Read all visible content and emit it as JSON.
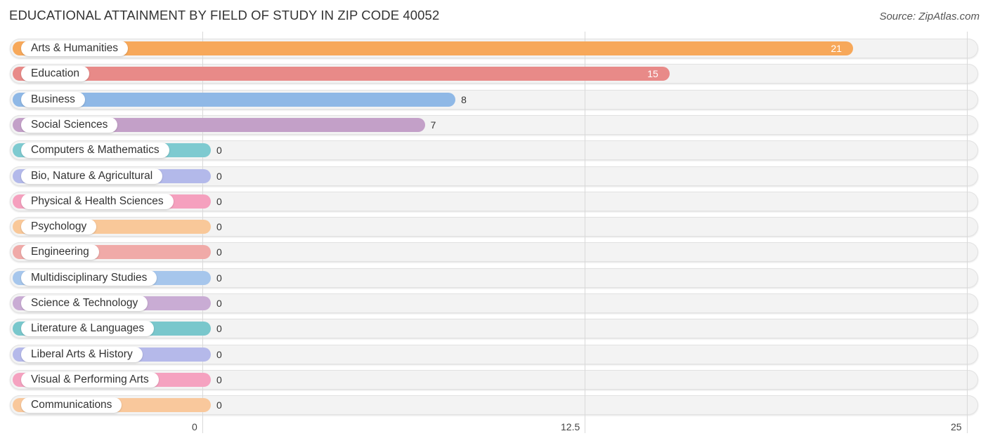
{
  "title": "EDUCATIONAL ATTAINMENT BY FIELD OF STUDY IN ZIP CODE 40052",
  "source": "Source: ZipAtlas.com",
  "chart_data": {
    "type": "bar",
    "orientation": "horizontal",
    "title": "EDUCATIONAL ATTAINMENT BY FIELD OF STUDY IN ZIP CODE 40052",
    "xlabel": "",
    "ylabel": "",
    "xlim": [
      0,
      25
    ],
    "xticks": [
      "0",
      "12.5",
      "25"
    ],
    "grid": true,
    "categories": [
      "Arts & Humanities",
      "Education",
      "Business",
      "Social Sciences",
      "Computers & Mathematics",
      "Bio, Nature & Agricultural",
      "Physical & Health Sciences",
      "Psychology",
      "Engineering",
      "Multidisciplinary Studies",
      "Science & Technology",
      "Literature & Languages",
      "Liberal Arts & History",
      "Visual & Performing Arts",
      "Communications"
    ],
    "values": [
      21,
      15,
      8,
      7,
      0,
      0,
      0,
      0,
      0,
      0,
      0,
      0,
      0,
      0,
      0
    ],
    "value_labels": [
      "21",
      "15",
      "8",
      "7",
      "0",
      "0",
      "0",
      "0",
      "0",
      "0",
      "0",
      "0",
      "0",
      "0",
      "0"
    ],
    "colors": [
      "#f7a85a",
      "#e88a88",
      "#8fb8e6",
      "#c3a0c8",
      "#7ecad0",
      "#b3b9ea",
      "#f5a0be",
      "#f9c899",
      "#f0aaa8",
      "#a6c6ec",
      "#c9acd4",
      "#79c7cc",
      "#b5b9ea",
      "#f5a2c0",
      "#f9c89c"
    ]
  }
}
